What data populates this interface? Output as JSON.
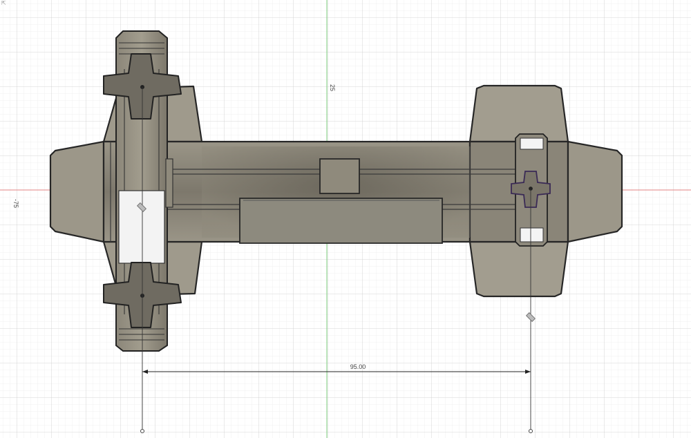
{
  "corner_label": "⇱",
  "ruler": {
    "top_value": "25",
    "left_value": "-75"
  },
  "dimension": {
    "value": "95.00"
  },
  "colors": {
    "grid_minor": "#e4e4e4",
    "grid_major": "#cfcfcf",
    "axis_x": "#e07070",
    "axis_y": "#6cc56c",
    "body": "#8c8779",
    "body_dark": "#6f6b60",
    "body_light": "#aaa597",
    "outline": "#2b2b2b"
  },
  "icons": [
    "move-handle-icon",
    "move-handle-icon"
  ]
}
